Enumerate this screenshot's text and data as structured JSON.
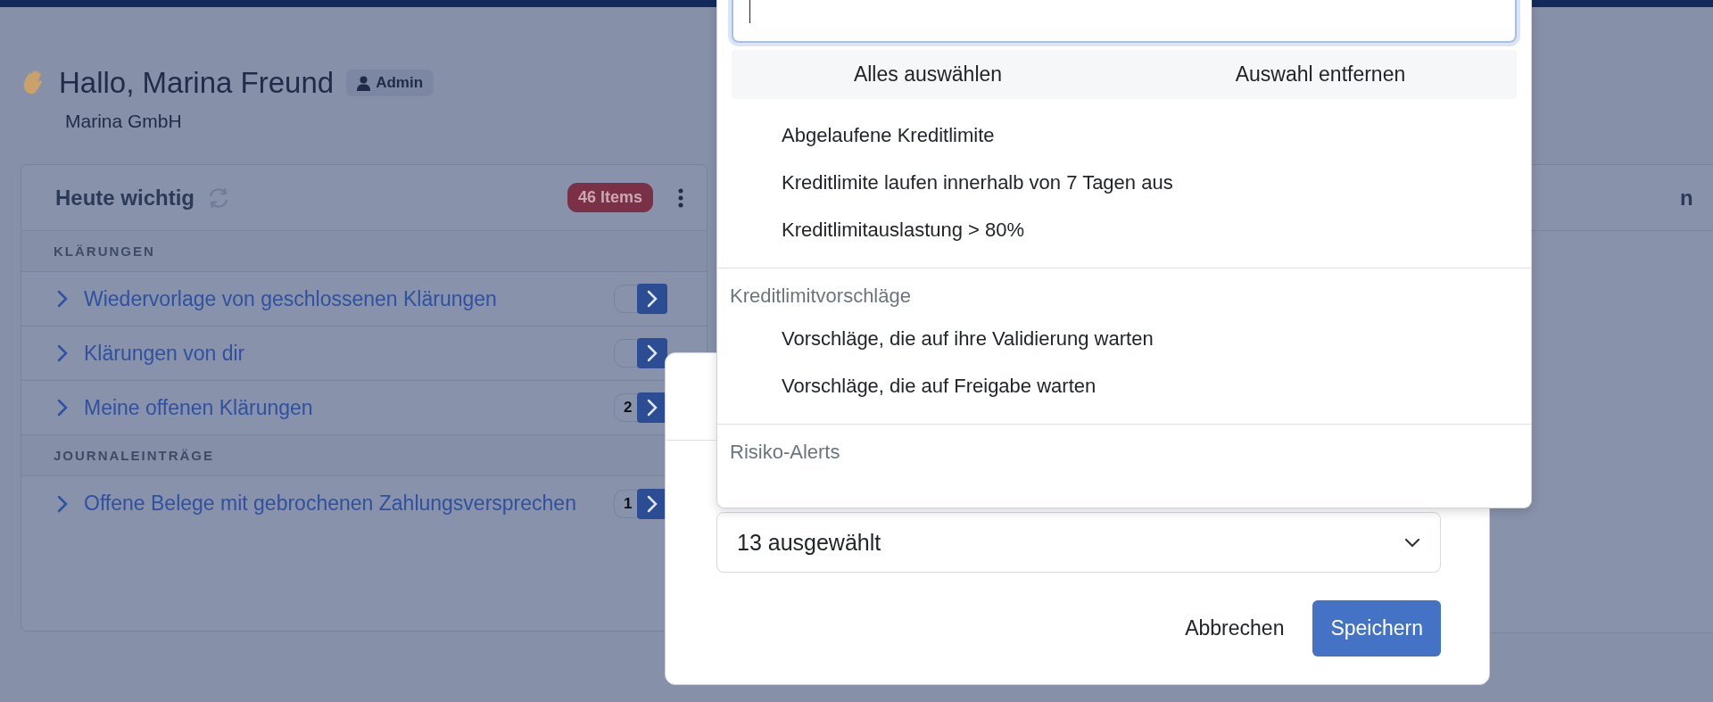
{
  "header": {
    "greeting": "Hallo, Marina Freund",
    "role": "Admin",
    "company": "Marina GmbH"
  },
  "card": {
    "title": "Heute wichtig",
    "badge": "46 Items",
    "sections": [
      {
        "title": "KLÄRUNGEN",
        "items": [
          {
            "label": "Wiedervorlage von geschlossenen Klärungen"
          },
          {
            "label": "Klärungen von dir"
          },
          {
            "label": "Meine offenen Klärungen",
            "count": "2"
          }
        ]
      },
      {
        "title": "JOURNALEINTRÄGE",
        "items": [
          {
            "label": "Offene Belege mit gebrochenen Zahlungsversprechen",
            "count": "1"
          }
        ]
      }
    ]
  },
  "side_card": {
    "title": "n"
  },
  "dialog": {
    "select": {
      "value": "13 ausgewählt",
      "expanded": true
    },
    "buttons": [
      {
        "label": "Abbrechen",
        "kind": "secondary"
      },
      {
        "label": "Speichern",
        "kind": "primary"
      }
    ]
  },
  "dropdown": {
    "actions": [
      "Alles auswählen",
      "Auswahl entfernen"
    ],
    "groups": [
      {
        "options": [
          "Abgelaufene Kreditlimite",
          "Kreditlimite laufen innerhalb von 7 Tagen aus",
          "Kreditlimitauslastung > 80%"
        ]
      },
      {
        "title": "Kreditlimitvorschläge",
        "options": [
          "Vorschläge, die auf ihre Validierung warten",
          "Vorschläge, die auf Freigabe warten"
        ]
      },
      {
        "title": "Risiko-Alerts"
      }
    ]
  }
}
